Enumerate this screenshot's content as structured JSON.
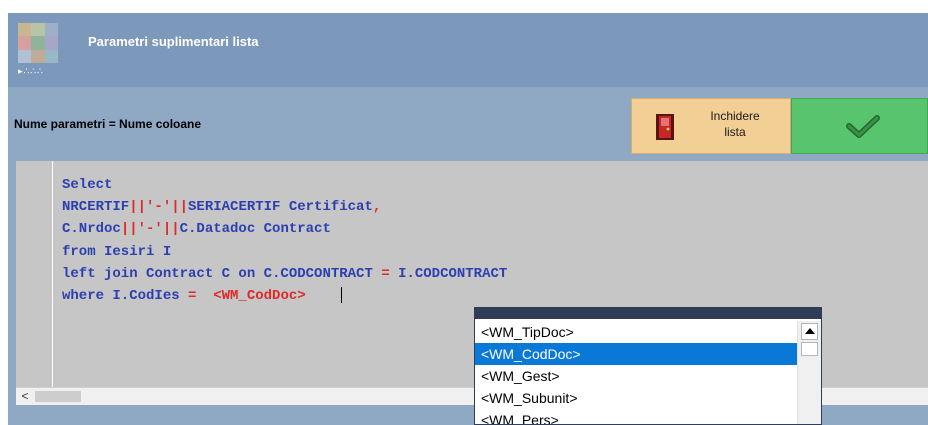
{
  "window": {
    "title": "Parametri suplimentari lista",
    "logo_dots": "▸∴∴∴"
  },
  "subheader": {
    "param_label": "Nume parametri = Nume coloane"
  },
  "toolbar": {
    "close_list_line1": "Inchidere",
    "close_list_line2": "lista",
    "close_icon": "door-exit-icon",
    "ok_icon": "checkmark-icon",
    "ok_color": "#58c56e",
    "close_color": "#f2cf95"
  },
  "editor": {
    "line1": "Select",
    "line2": {
      "a": "NRCERTIF",
      "b": "||'-'||",
      "c": "SERIACERTIF Certificat",
      "d": ","
    },
    "line3": {
      "a": "C.Nrdoc",
      "b": "||'-'||",
      "c": "C.Datadoc Contract"
    },
    "line4": "from Iesiri I",
    "line5": {
      "a": "left join Contract C on C.CODCONTRACT ",
      "b": "=",
      "c": " I.CODCONTRACT"
    },
    "line6": {
      "a": "where I.CodIes ",
      "b": "=",
      "c": "  ",
      "d": "<WM_CodDoc>"
    },
    "keyword_color": "#2c3fb0",
    "operator_color": "#e02a2a"
  },
  "hscroll": {
    "left_arrow": "<"
  },
  "autocomplete": {
    "options": [
      "<WM_TipDoc>",
      "<WM_CodDoc>",
      "<WM_Gest>",
      "<WM_Subunit>",
      "<WM_Pers>"
    ],
    "selected": "<WM_CodDoc>",
    "selection_color": "#0a78d7"
  }
}
